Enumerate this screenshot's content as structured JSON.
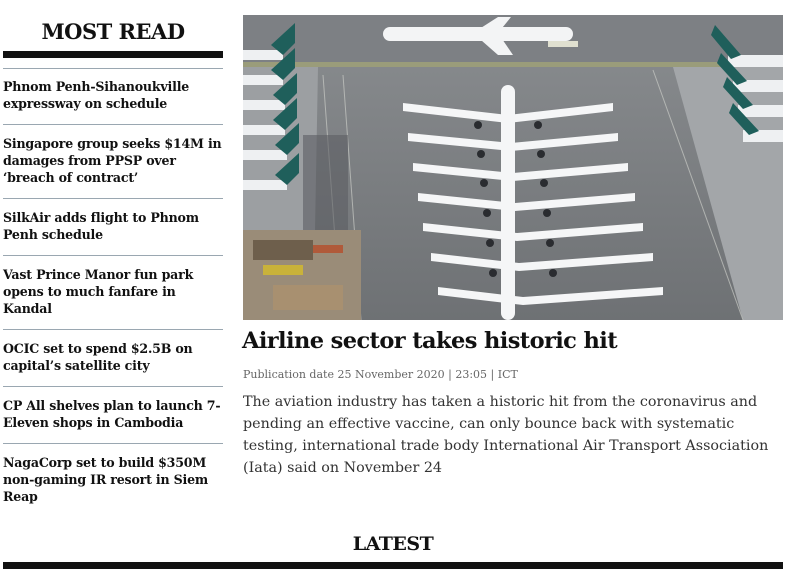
{
  "most_read": {
    "title": "MOST READ",
    "items": [
      {
        "label": "Phnom Penh-Sihanoukville expressway on schedule"
      },
      {
        "label": "Singapore group seeks $14M in damages from PPSP over ‘breach of contract’"
      },
      {
        "label": "SilkAir adds flight to Phnom Penh schedule"
      },
      {
        "label": "Vast Prince Manor fun park opens to much fanfare in Kandal"
      },
      {
        "label": "OCIC set to spend $2.5B on capital’s satellite city"
      },
      {
        "label": "CP All shelves plan to launch 7-Eleven shops in Cambodia"
      },
      {
        "label": "NagaCorp set to build $350M non-gaming IR resort in Siem Reap"
      }
    ]
  },
  "article": {
    "image_alt": "Parked airliners lined up on an airport apron",
    "headline": "Airline sector takes historic hit",
    "meta": "Publication date 25 November 2020 | 23:05 | ICT",
    "summary": "The aviation industry has taken a historic hit from the coronavirus and pending an effective vaccine, can only bounce back with systematic testing, international trade body International Air Transport Association (Iata) said on November 24"
  },
  "latest": {
    "title": "LATEST"
  },
  "colors": {
    "text": "#111111",
    "divider": "#9aa7b1",
    "meta": "#666666"
  }
}
